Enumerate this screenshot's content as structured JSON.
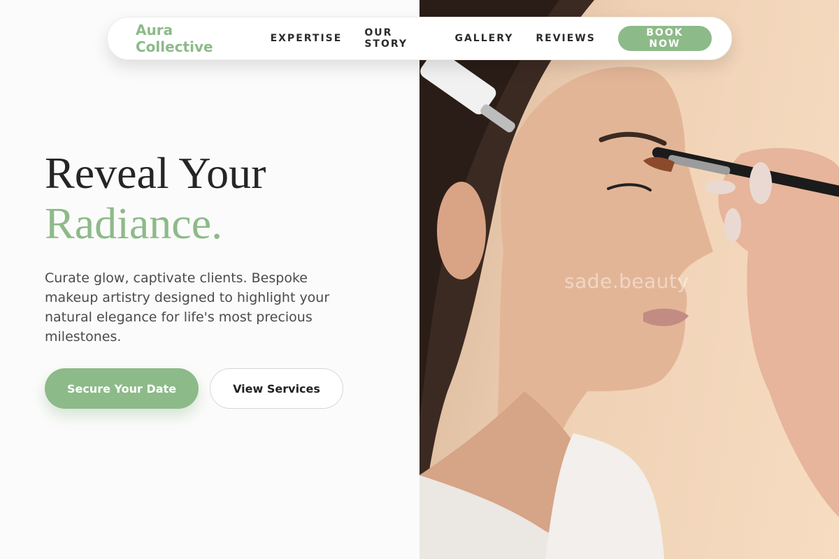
{
  "nav": {
    "brand": "Aura Collective",
    "links": [
      "EXPERTISE",
      "OUR STORY",
      "GALLERY",
      "REVIEWS"
    ],
    "cta": "BOOK NOW"
  },
  "hero": {
    "title_line1": "Reveal Your",
    "title_line2": "Radiance.",
    "description": "Curate glow, captivate clients. Bespoke makeup artistry designed to highlight your natural elegance for life's most precious milestones.",
    "primary_button": "Secure Your Date",
    "secondary_button": "View Services"
  },
  "photo": {
    "watermark": "sade.beauty"
  },
  "colors": {
    "accent": "#8dba89",
    "text_dark": "#252525",
    "background": "#fcfbfb"
  }
}
